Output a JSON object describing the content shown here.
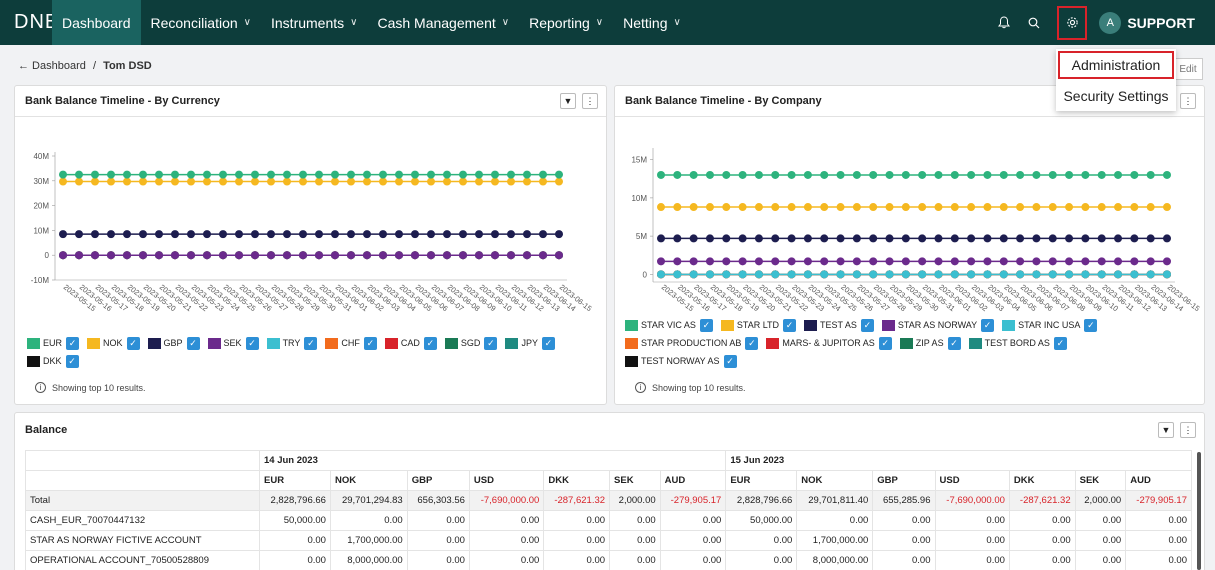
{
  "nav": {
    "logo": "DNB",
    "items": [
      {
        "label": "Dashboard",
        "active": true,
        "dropdown": false
      },
      {
        "label": "Reconciliation",
        "dropdown": true
      },
      {
        "label": "Instruments",
        "dropdown": true
      },
      {
        "label": "Cash Management",
        "dropdown": true
      },
      {
        "label": "Reporting",
        "dropdown": true
      },
      {
        "label": "Netting",
        "dropdown": true
      }
    ],
    "icons": [
      "bell-icon",
      "search-icon",
      "gear-icon"
    ],
    "user_initial": "A",
    "user": "SUPPORT"
  },
  "breadcrumb": {
    "back": "← Dashboard",
    "sep": "/",
    "current": "Tom DSD"
  },
  "edit_label": "Edit",
  "menu": {
    "items": [
      "Administration",
      "Security Settings"
    ]
  },
  "colors": {
    "nav_bg": "#0d3d3b",
    "nav_active": "#1a6360",
    "highlight": "#d8232a",
    "check": "#2d8fd6"
  },
  "panels": {
    "currency": {
      "title": "Bank Balance Timeline - By Currency",
      "note": "Showing top 10 results."
    },
    "company": {
      "title": "Bank Balance Timeline - By Company",
      "note": "Showing top 10 results."
    },
    "balance": {
      "title": "Balance"
    }
  },
  "chart_data": [
    {
      "type": "line",
      "title": "Bank Balance Timeline - By Currency",
      "x": [
        "2023-05-15",
        "2023-05-16",
        "2023-05-17",
        "2023-05-18",
        "2023-05-19",
        "2023-05-20",
        "2023-05-21",
        "2023-05-22",
        "2023-05-23",
        "2023-05-24",
        "2023-05-25",
        "2023-05-26",
        "2023-05-27",
        "2023-05-28",
        "2023-05-29",
        "2023-05-30",
        "2023-05-31",
        "2023-06-01",
        "2023-06-02",
        "2023-06-03",
        "2023-06-04",
        "2023-06-05",
        "2023-06-06",
        "2023-06-07",
        "2023-06-08",
        "2023-06-09",
        "2023-06-10",
        "2023-06-11",
        "2023-06-12",
        "2023-06-13",
        "2023-06-14",
        "2023-06-15"
      ],
      "y_ticks": [
        "40M",
        "30M",
        "20M",
        "10M",
        "0",
        "-10M"
      ],
      "ylim": [
        -10000000,
        40000000
      ],
      "series": [
        {
          "name": "EUR",
          "color": "#2db37d",
          "level": 32500000
        },
        {
          "name": "NOK",
          "color": "#f5b820",
          "level": 29700000
        },
        {
          "name": "GBP",
          "color": "#1d1d4f",
          "level": 8500000
        },
        {
          "name": "SEK",
          "color": "#6b2a8c",
          "level": 0
        },
        {
          "name": "TRY",
          "color": "#3bbfd0",
          "level": 0
        },
        {
          "name": "CHF",
          "color": "#f26b1d",
          "level": 0
        },
        {
          "name": "CAD",
          "color": "#d8232a",
          "level": 0
        },
        {
          "name": "SGD",
          "color": "#1a7a55",
          "level": 0
        },
        {
          "name": "JPY",
          "color": "#1f8a80",
          "level": 0
        },
        {
          "name": "DKK",
          "color": "#111111",
          "level": 0
        }
      ]
    },
    {
      "type": "line",
      "title": "Bank Balance Timeline - By Company",
      "x": [
        "2023-05-15",
        "2023-05-16",
        "2023-05-17",
        "2023-05-18",
        "2023-05-19",
        "2023-05-20",
        "2023-05-21",
        "2023-05-22",
        "2023-05-23",
        "2023-05-24",
        "2023-05-25",
        "2023-05-26",
        "2023-05-27",
        "2023-05-28",
        "2023-05-29",
        "2023-05-30",
        "2023-05-31",
        "2023-06-01",
        "2023-06-02",
        "2023-06-03",
        "2023-06-04",
        "2023-06-05",
        "2023-06-06",
        "2023-06-07",
        "2023-06-08",
        "2023-06-09",
        "2023-06-10",
        "2023-06-11",
        "2023-06-12",
        "2023-06-13",
        "2023-06-14",
        "2023-06-15"
      ],
      "y_ticks": [
        "15M",
        "10M",
        "5M",
        "0"
      ],
      "ylim": [
        -1000000,
        16000000
      ],
      "series": [
        {
          "name": "STAR VIC AS",
          "color": "#2db37d",
          "level": 13000000
        },
        {
          "name": "STAR LTD",
          "color": "#f5b820",
          "level": 8800000
        },
        {
          "name": "TEST AS",
          "color": "#1d1d4f",
          "level": 4700000
        },
        {
          "name": "STAR AS NORWAY",
          "color": "#6b2a8c",
          "level": 1700000
        },
        {
          "name": "STAR INC USA",
          "color": "#3bbfd0",
          "level": 0
        },
        {
          "name": "STAR PRODUCTION AB",
          "color": "#f26b1d",
          "level": 0
        },
        {
          "name": "MARS- & JUPITOR AS",
          "color": "#d8232a",
          "level": 0
        },
        {
          "name": "ZIP AS",
          "color": "#1a7a55",
          "level": 0
        },
        {
          "name": "TEST BORD AS",
          "color": "#1f8a80",
          "level": 0
        },
        {
          "name": "TEST NORWAY AS",
          "color": "#111111",
          "level": 0
        }
      ]
    }
  ],
  "balance_table": {
    "dates": [
      "14 Jun 2023",
      "15 Jun 2023"
    ],
    "currencies": [
      "EUR",
      "NOK",
      "GBP",
      "USD",
      "DKK",
      "SEK",
      "AUD"
    ],
    "rows": [
      {
        "label": "Total",
        "values": [
          "2,828,796.66",
          "29,701,294.83",
          "656,303.56",
          "-7,690,000.00",
          "-287,621.32",
          "2,000.00",
          "-279,905.17",
          "2,828,796.66",
          "29,701,811.40",
          "655,285.96",
          "-7,690,000.00",
          "-287,621.32",
          "2,000.00",
          "-279,905.17"
        ]
      },
      {
        "label": "CASH_EUR_70070447132",
        "values": [
          "50,000.00",
          "0.00",
          "0.00",
          "0.00",
          "0.00",
          "0.00",
          "0.00",
          "50,000.00",
          "0.00",
          "0.00",
          "0.00",
          "0.00",
          "0.00",
          "0.00"
        ]
      },
      {
        "label": "STAR AS NORWAY FICTIVE ACCOUNT",
        "values": [
          "0.00",
          "1,700,000.00",
          "0.00",
          "0.00",
          "0.00",
          "0.00",
          "0.00",
          "0.00",
          "1,700,000.00",
          "0.00",
          "0.00",
          "0.00",
          "0.00",
          "0.00"
        ]
      },
      {
        "label": "OPERATIONAL ACCOUNT_70500528809",
        "values": [
          "0.00",
          "8,000,000.00",
          "0.00",
          "0.00",
          "0.00",
          "0.00",
          "0.00",
          "0.00",
          "8,000,000.00",
          "0.00",
          "0.00",
          "0.00",
          "0.00",
          "0.00"
        ]
      }
    ]
  }
}
